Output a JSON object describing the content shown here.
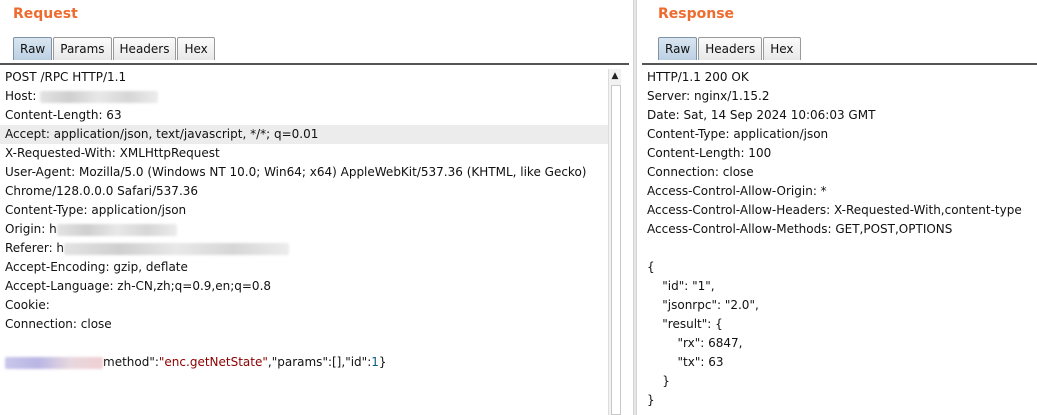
{
  "request": {
    "title": "Request",
    "tabs": [
      {
        "label": "Raw",
        "active": true
      },
      {
        "label": "Params",
        "active": false
      },
      {
        "label": "Headers",
        "active": false
      },
      {
        "label": "Hex",
        "active": false
      }
    ],
    "lines": {
      "request_line": "POST /RPC HTTP/1.1",
      "host": "Host:",
      "content_length": "Content-Length: 63",
      "accept": "Accept: application/json, text/javascript, */*; q=0.01",
      "x_requested_with": "X-Requested-With: XMLHttpRequest",
      "user_agent_1": "User-Agent: Mozilla/5.0 (Windows NT 10.0; Win64; x64) AppleWebKit/537.36 (KHTML, like Gecko)",
      "user_agent_2": "Chrome/128.0.0.0 Safari/537.36",
      "content_type": "Content-Type: application/json",
      "origin": "Origin: h",
      "referer": "Referer: h",
      "accept_encoding": "Accept-Encoding: gzip, deflate",
      "accept_language": "Accept-Language: zh-CN,zh;q=0.9,en;q=0.8",
      "cookie": "Cookie:",
      "connection": "Connection: close",
      "body": {
        "method_key": "method\":",
        "method_value": "\"enc.getNetState\"",
        "comma1": ",",
        "params_key": "\"params\":",
        "params_value": "[]",
        "comma2": ",",
        "id_key": "\"id\":",
        "id_value": "1",
        "close": "}"
      }
    }
  },
  "response": {
    "title": "Response",
    "tabs": [
      {
        "label": "Raw",
        "active": true
      },
      {
        "label": "Headers",
        "active": false
      },
      {
        "label": "Hex",
        "active": false
      }
    ],
    "lines": {
      "status": "HTTP/1.1 200 OK",
      "server": "Server: nginx/1.15.2",
      "date": "Date: Sat, 14 Sep 2024 10:06:03 GMT",
      "content_type": "Content-Type: application/json",
      "content_length": "Content-Length: 100",
      "connection": "Connection: close",
      "acao": "Access-Control-Allow-Origin: *",
      "acah": "Access-Control-Allow-Headers: X-Requested-With,content-type",
      "acam": "Access-Control-Allow-Methods: GET,POST,OPTIONS",
      "json_open": "{",
      "json_id": "    \"id\": \"1\",",
      "json_rpc": "    \"jsonrpc\": \"2.0\",",
      "json_result": "    \"result\": {",
      "json_rx": "        \"rx\": 6847,",
      "json_tx": "        \"tx\": 63",
      "json_result_close": "    }",
      "json_close": "}"
    }
  },
  "icons": {
    "scroll_up": "▲"
  },
  "colors": {
    "title_orange": "#ee6b2f",
    "tab_active_bg": "#c6d7e8"
  }
}
